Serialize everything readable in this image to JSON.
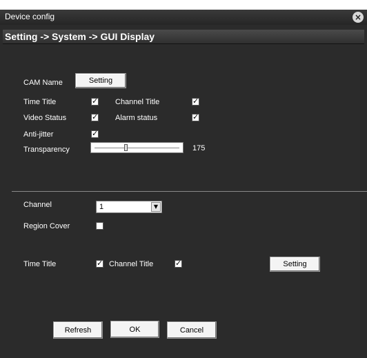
{
  "window": {
    "title": "Device config",
    "close_icon": "close-icon"
  },
  "breadcrumb": "Setting -> System -> GUI Display",
  "cam_name": {
    "label": "CAM Name",
    "button": "Setting"
  },
  "options": {
    "time_title": {
      "label": "Time Title",
      "checked": true
    },
    "channel_title": {
      "label": "Channel Title",
      "checked": true
    },
    "video_status": {
      "label": "Video Status",
      "checked": true
    },
    "alarm_status": {
      "label": "Alarm status",
      "checked": true
    },
    "anti_jitter": {
      "label": "Anti-jitter",
      "checked": true
    }
  },
  "transparency": {
    "label": "Transparency",
    "value": "175"
  },
  "channel": {
    "label": "Channel",
    "selected": "1"
  },
  "region_cover": {
    "label": "Region Cover",
    "checked": false
  },
  "overlay": {
    "time_title": {
      "label": "Time Title",
      "checked": true
    },
    "channel_title": {
      "label": "Channel Title",
      "checked": true
    },
    "button": "Setting"
  },
  "footer": {
    "refresh": "Refresh",
    "ok": "OK",
    "cancel": "Cancel"
  }
}
